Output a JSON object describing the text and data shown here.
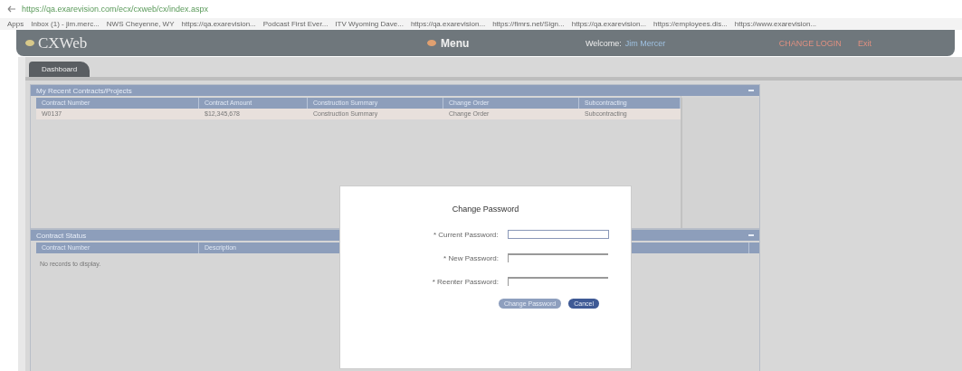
{
  "browser": {
    "url": "https://qa.exarevision.com/ecx/cxweb/cx/index.aspx",
    "bookmarks": [
      "Apps",
      "Inbox (1) - jim.merc...",
      "NWS Cheyenne, WY",
      "https://qa.exarevision...",
      "Podcast First Ever...",
      "ITV Wyoming Dave...",
      "https://qa.exarevision...",
      "https://fimrs.net/Sign...",
      "https://qa.exarevision...",
      "https://employees.dis...",
      "https://www.exarevision..."
    ]
  },
  "header": {
    "logo": "CXWeb",
    "menu": "Menu",
    "welcome": "Welcome:",
    "user": "Jim Mercer",
    "links": [
      "CHANGE LOGIN",
      "Exit"
    ]
  },
  "tabs": [
    {
      "label": "Dashboard",
      "selected": true
    }
  ],
  "panels": [
    {
      "title": "My Recent Contracts/Projects",
      "columns": [
        "Contract Number",
        "Contract Amount",
        "Construction Summary",
        "Change Order",
        "Subcontracting"
      ],
      "rows": [
        [
          "W0137",
          "$12,345,678",
          "Construction Summary",
          "Change Order",
          "Subcontracting"
        ]
      ]
    },
    {
      "title": "Contract Status",
      "columns": [
        "Contract Number",
        "Description"
      ],
      "empty": "No records to display."
    }
  ],
  "dialog": {
    "title": "Change Password",
    "fields": [
      {
        "label": "* Current Password:",
        "focused": true
      },
      {
        "label": "* New Password:",
        "focused": false
      },
      {
        "label": "* Reenter Password:",
        "focused": false
      }
    ],
    "buttons": [
      {
        "label": "Change Password",
        "primary": false
      },
      {
        "label": "Cancel",
        "primary": true
      }
    ]
  }
}
